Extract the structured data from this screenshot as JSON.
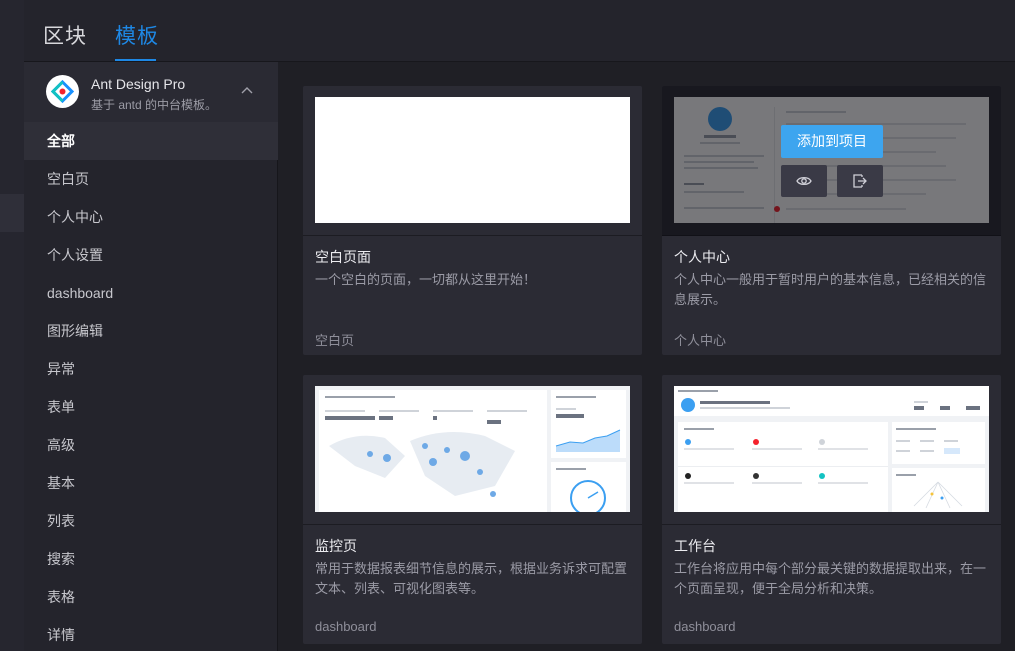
{
  "tabs": [
    {
      "label": "区块",
      "active": false
    },
    {
      "label": "模板",
      "active": true
    }
  ],
  "project": {
    "name": "Ant Design Pro",
    "description": "基于 antd 的中台模板。"
  },
  "menu": [
    {
      "label": "全部",
      "active": true
    },
    {
      "label": "空白页"
    },
    {
      "label": "个人中心"
    },
    {
      "label": "个人设置"
    },
    {
      "label": "dashboard"
    },
    {
      "label": "图形编辑"
    },
    {
      "label": "异常"
    },
    {
      "label": "表单"
    },
    {
      "label": "高级"
    },
    {
      "label": "基本"
    },
    {
      "label": "列表"
    },
    {
      "label": "搜索"
    },
    {
      "label": "表格"
    },
    {
      "label": "详情"
    }
  ],
  "cards": [
    {
      "title": "空白页面",
      "description": "一个空白的页面，一切都从这里开始！",
      "tag": "空白页"
    },
    {
      "title": "个人中心",
      "description": "个人中心一般用于暂时用户的基本信息，已经相关的信息展示。",
      "tag": "个人中心",
      "hover": {
        "add_label": "添加到项目",
        "preview_icon": "eye-icon",
        "export_icon": "export-icon"
      }
    },
    {
      "title": "监控页",
      "description": "常用于数据报表细节信息的展示，根据业务诉求可配置文本、列表、可视化图表等。",
      "tag": "dashboard"
    },
    {
      "title": "工作台",
      "description": "工作台将应用中每个部分最关键的数据提取出来，在一个页面呈现，便于全局分析和决策。",
      "tag": "dashboard"
    }
  ],
  "colors": {
    "accent": "#1e88e5",
    "button": "#3da5ef",
    "background": "#1f1f25",
    "card": "#2b2b34"
  }
}
